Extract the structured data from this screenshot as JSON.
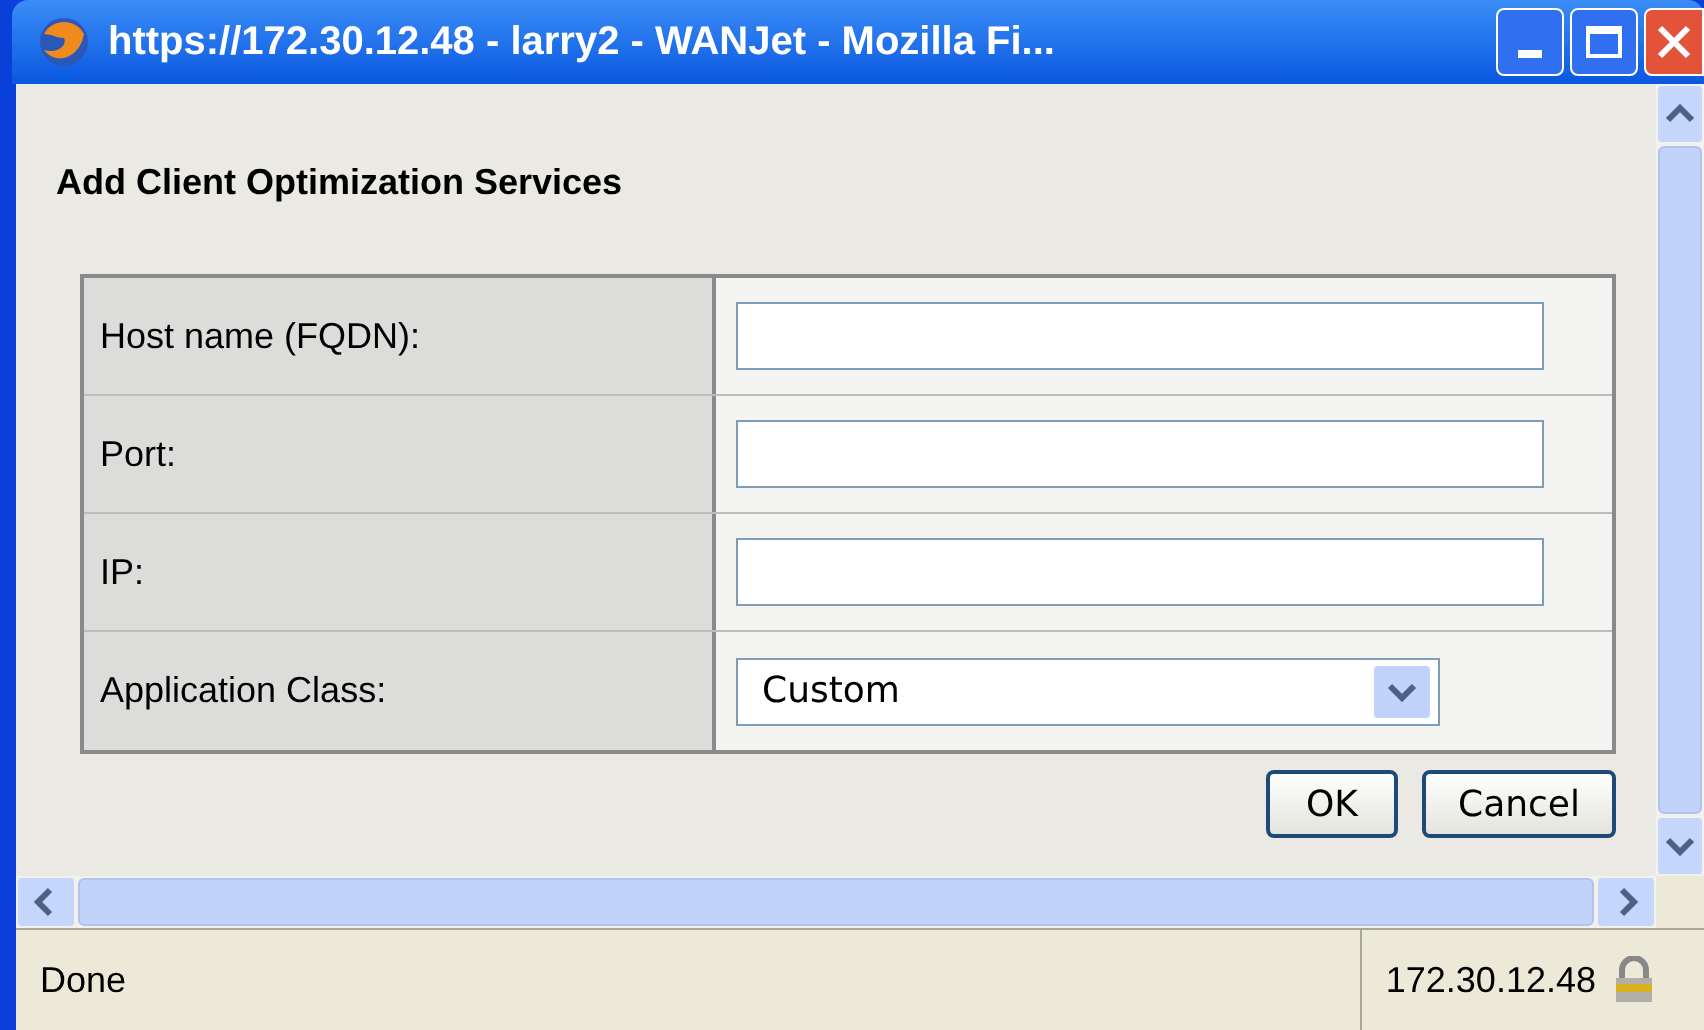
{
  "window": {
    "title": "https://172.30.12.48 - larry2 - WANJet - Mozilla Fi..."
  },
  "heading": "Add Client Optimization Services",
  "fields": [
    {
      "label": "Host name (FQDN):",
      "kind": "text"
    },
    {
      "label": "Port:",
      "kind": "text"
    },
    {
      "label": "IP:",
      "kind": "text"
    },
    {
      "label": "Application Class:",
      "kind": "select",
      "value": "Custom"
    }
  ],
  "buttons": [
    "OK",
    "Cancel"
  ],
  "status_bar": {
    "text": "Done",
    "address": "172.30.12.48"
  }
}
